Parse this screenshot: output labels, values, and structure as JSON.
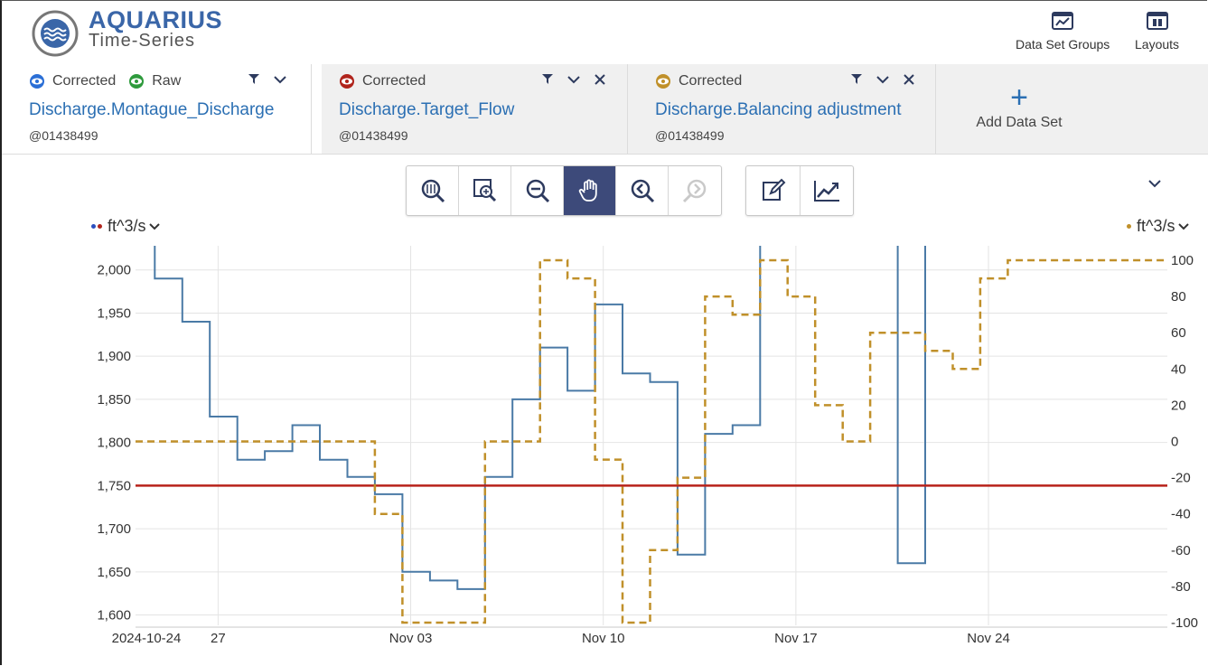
{
  "app": {
    "brand_name": "AQUARIUS",
    "brand_sub": "Time-Series",
    "header_buttons": [
      {
        "label": "Data Set Groups",
        "icon": "chart-window-icon"
      },
      {
        "label": "Layouts",
        "icon": "layout-icon"
      }
    ]
  },
  "tabs": [
    {
      "flags": [
        {
          "label": "Corrected",
          "eye_color": "#2b6fd6"
        },
        {
          "label": "Raw",
          "eye_color": "#2e9a3c"
        }
      ],
      "series": "Discharge.Montague_Discharge",
      "site": "@01438499",
      "closable": false,
      "active": true
    },
    {
      "flags": [
        {
          "label": "Corrected",
          "eye_color": "#b0241c"
        }
      ],
      "series": "Discharge.Target_Flow",
      "site": "@01438499",
      "closable": true,
      "active": false
    },
    {
      "flags": [
        {
          "label": "Corrected",
          "eye_color": "#c0902a"
        }
      ],
      "series": "Discharge.Balancing adjustment",
      "site": "@01438499",
      "closable": true,
      "active": false
    }
  ],
  "add_data_set": {
    "label": "Add Data Set",
    "icon": "plus-icon"
  },
  "toolbar": {
    "group1": [
      {
        "name": "zoom-extents-button",
        "icon": "zoom-extents-icon",
        "active": false
      },
      {
        "name": "zoom-box-button",
        "icon": "zoom-box-icon",
        "active": false
      },
      {
        "name": "zoom-out-button",
        "icon": "zoom-out-icon",
        "active": false
      },
      {
        "name": "pan-button",
        "icon": "hand-icon",
        "active": true
      },
      {
        "name": "zoom-previous-button",
        "icon": "zoom-previous-icon",
        "active": false
      },
      {
        "name": "zoom-next-button",
        "icon": "zoom-next-icon",
        "active": false,
        "disabled": true
      }
    ],
    "group2": [
      {
        "name": "edit-button",
        "icon": "edit-icon",
        "active": false
      },
      {
        "name": "trend-button",
        "icon": "trend-icon",
        "active": false
      }
    ]
  },
  "chart_data": {
    "type": "line",
    "left_axis": {
      "unit": "ft^3/s",
      "ticks": [
        1600,
        1650,
        1700,
        1750,
        1800,
        1850,
        1900,
        1950,
        2000
      ],
      "tick_labels": [
        "1,600",
        "1,650",
        "1,700",
        "1,750",
        "1,800",
        "1,850",
        "1,900",
        "1,950",
        "2,000"
      ],
      "range": [
        1588,
        2028
      ]
    },
    "right_axis": {
      "unit": "ft^3/s",
      "ticks": [
        -100,
        -80,
        -60,
        -40,
        -20,
        0,
        20,
        40,
        60,
        80,
        100
      ],
      "range": [
        -101.5,
        108
      ]
    },
    "x_axis": {
      "start": "2024-10-24",
      "tick_labels": [
        {
          "day": 0,
          "label": "2024-10-24"
        },
        {
          "day": 3,
          "label": "27"
        },
        {
          "day": 10,
          "label": "Nov 03"
        },
        {
          "day": 17,
          "label": "Nov 10"
        },
        {
          "day": 24,
          "label": "Nov 17"
        },
        {
          "day": 31,
          "label": "Nov 24"
        }
      ],
      "range": [
        0,
        37.5
      ]
    },
    "grid": true,
    "series": [
      {
        "name": "Discharge.Montague_Discharge",
        "axis": "left",
        "color": "#4a7aa6",
        "style": "step",
        "points": [
          [
            0.7,
            2030
          ],
          [
            0.7,
            1990
          ],
          [
            1.7,
            1990
          ],
          [
            1.7,
            1940
          ],
          [
            2.7,
            1940
          ],
          [
            2.7,
            1830
          ],
          [
            3.7,
            1830
          ],
          [
            3.7,
            1780
          ],
          [
            4.7,
            1780
          ],
          [
            4.7,
            1790
          ],
          [
            5.7,
            1790
          ],
          [
            5.7,
            1820
          ],
          [
            6.7,
            1820
          ],
          [
            6.7,
            1780
          ],
          [
            7.7,
            1780
          ],
          [
            7.7,
            1760
          ],
          [
            8.7,
            1760
          ],
          [
            8.7,
            1740
          ],
          [
            9.7,
            1740
          ],
          [
            9.7,
            1650
          ],
          [
            10.7,
            1650
          ],
          [
            10.7,
            1640
          ],
          [
            11.7,
            1640
          ],
          [
            11.7,
            1630
          ],
          [
            12.7,
            1630
          ],
          [
            12.7,
            1760
          ],
          [
            13.7,
            1760
          ],
          [
            13.7,
            1850
          ],
          [
            14.7,
            1850
          ],
          [
            14.7,
            1910
          ],
          [
            15.7,
            1910
          ],
          [
            15.7,
            1860
          ],
          [
            16.7,
            1860
          ],
          [
            16.7,
            1960
          ],
          [
            17.7,
            1960
          ],
          [
            17.7,
            1880
          ],
          [
            18.7,
            1880
          ],
          [
            18.7,
            1870
          ],
          [
            19.7,
            1870
          ],
          [
            19.7,
            1670
          ],
          [
            20.7,
            1670
          ],
          [
            20.7,
            1810
          ],
          [
            21.7,
            1810
          ],
          [
            21.7,
            1820
          ],
          [
            22.7,
            1820
          ],
          [
            22.7,
            2030
          ]
        ],
        "segments2": [
          [
            [
              27.7,
              2030
            ],
            [
              27.7,
              1660
            ],
            [
              28.7,
              1660
            ],
            [
              28.7,
              2030
            ]
          ]
        ]
      },
      {
        "name": "Discharge.Target_Flow",
        "axis": "left",
        "color": "#b8221a",
        "style": "flat",
        "value": 1750
      },
      {
        "name": "Discharge.Balancing adjustment",
        "axis": "right",
        "color": "#c0902a",
        "style": "dashed-step",
        "points": [
          [
            0,
            0
          ],
          [
            8.7,
            0
          ],
          [
            8.7,
            -40
          ],
          [
            9.7,
            -40
          ],
          [
            9.7,
            -100
          ],
          [
            12.7,
            -100
          ],
          [
            12.7,
            0
          ],
          [
            14.7,
            0
          ],
          [
            14.7,
            100
          ],
          [
            15.7,
            100
          ],
          [
            15.7,
            90
          ],
          [
            16.7,
            90
          ],
          [
            16.7,
            -10
          ],
          [
            17.7,
            -10
          ],
          [
            17.7,
            -100
          ],
          [
            18.7,
            -100
          ],
          [
            18.7,
            -60
          ],
          [
            19.7,
            -60
          ],
          [
            19.7,
            -20
          ],
          [
            20.7,
            -20
          ],
          [
            20.7,
            80
          ],
          [
            21.7,
            80
          ],
          [
            21.7,
            70
          ],
          [
            22.7,
            70
          ],
          [
            22.7,
            100
          ],
          [
            23.7,
            100
          ],
          [
            23.7,
            80
          ],
          [
            24.7,
            80
          ],
          [
            24.7,
            20
          ],
          [
            25.7,
            20
          ],
          [
            25.7,
            0
          ],
          [
            26.7,
            0
          ],
          [
            26.7,
            60
          ],
          [
            28.7,
            60
          ],
          [
            28.7,
            50
          ],
          [
            29.7,
            50
          ],
          [
            29.7,
            40
          ],
          [
            30.7,
            40
          ],
          [
            30.7,
            90
          ],
          [
            31.7,
            90
          ],
          [
            31.7,
            100
          ],
          [
            37.5,
            100
          ]
        ]
      }
    ]
  }
}
